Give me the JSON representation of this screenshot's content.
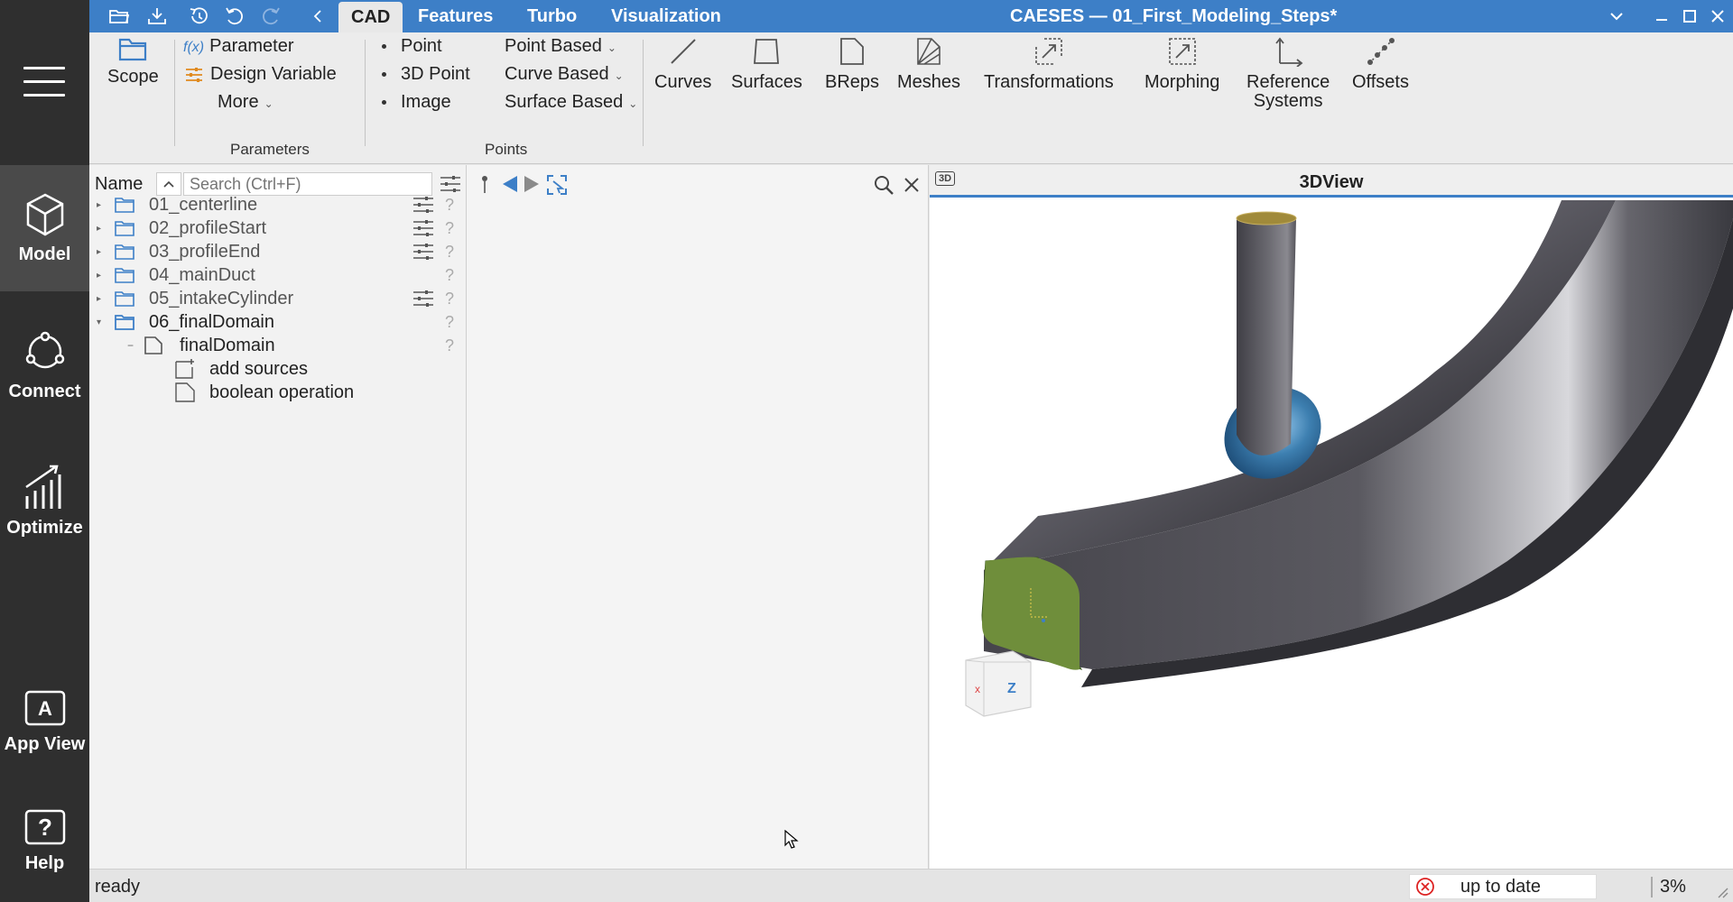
{
  "rail": {
    "items": [
      {
        "label": "Model"
      },
      {
        "label": "Connect"
      },
      {
        "label": "Optimize"
      },
      {
        "label": "App View"
      },
      {
        "label": "Help"
      }
    ]
  },
  "menu": {
    "tabs": [
      "CAD",
      "Features",
      "Turbo",
      "Visualization"
    ]
  },
  "window": {
    "title": "CAESES — 01_First_Modeling_Steps*"
  },
  "ribbon": {
    "scope": "Scope",
    "parameter_prefix": "f(x)",
    "parameter": "Parameter",
    "design_variable": "Design Variable",
    "more": "More",
    "parameters_group": "Parameters",
    "point": "Point",
    "point3d": "3D Point",
    "image": "Image",
    "point_based": "Point Based",
    "curve_based": "Curve Based",
    "surface_based": "Surface Based",
    "points_group": "Points",
    "curves": "Curves",
    "surfaces": "Surfaces",
    "breps": "BReps",
    "meshes": "Meshes",
    "transformations": "Transformations",
    "morphing": "Morphing",
    "reference_systems_1": "Reference",
    "reference_systems_2": "Systems",
    "offsets": "Offsets"
  },
  "tree": {
    "header": "Name",
    "search_placeholder": "Search (Ctrl+F)",
    "rows": [
      {
        "label": "01_centerline"
      },
      {
        "label": "02_profileStart"
      },
      {
        "label": "03_profileEnd"
      },
      {
        "label": "04_mainDuct"
      },
      {
        "label": "05_intakeCylinder"
      },
      {
        "label": "06_finalDomain"
      },
      {
        "label": "finalDomain"
      },
      {
        "label": "add sources"
      },
      {
        "label": "boolean operation"
      }
    ],
    "help_mark": "?"
  },
  "view": {
    "title": "3DView",
    "badge": "3D",
    "cube_axis_x": "x",
    "cube_axis_z": "Z"
  },
  "status": {
    "left": "ready",
    "state": "up to date",
    "percent": "3%"
  }
}
